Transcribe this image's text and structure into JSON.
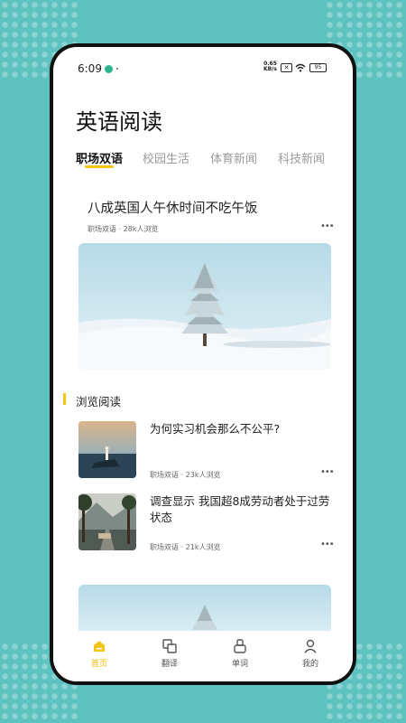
{
  "status_bar": {
    "time": "6:09",
    "net_speed_top": "0.65",
    "net_speed_bottom": "KB/s",
    "sim": "✕",
    "battery": "95"
  },
  "page": {
    "title": "英语阅读"
  },
  "tabs": [
    {
      "label": "职场双语",
      "active": true
    },
    {
      "label": "校园生活",
      "active": false
    },
    {
      "label": "体育新闻",
      "active": false
    },
    {
      "label": "科技新闻",
      "active": false
    }
  ],
  "featured": {
    "title": "八成英国人午休时间不吃午饭",
    "category": "职场双语",
    "separator": "·",
    "views": "28k人浏览",
    "image_icon": "snowy-tree-image"
  },
  "section": {
    "title": "浏览阅读"
  },
  "list": [
    {
      "title": "为何实习机会那么不公平?",
      "category": "职场双语",
      "separator": "·",
      "views": "23k人浏览",
      "image_icon": "seaside-person-image"
    },
    {
      "title": "调查显示 我国超8成劳动者处于过劳状态",
      "category": "职场双语",
      "separator": "·",
      "views": "21k人浏览",
      "image_icon": "road-trip-image"
    }
  ],
  "bottom_nav": [
    {
      "label": "首页",
      "icon": "home-icon",
      "active": true
    },
    {
      "label": "翻译",
      "icon": "translate-icon",
      "active": false
    },
    {
      "label": "单词",
      "icon": "words-icon",
      "active": false
    },
    {
      "label": "我的",
      "icon": "profile-icon",
      "active": false
    }
  ],
  "colors": {
    "background": "#5ec3c0",
    "accent": "#f5c518"
  }
}
